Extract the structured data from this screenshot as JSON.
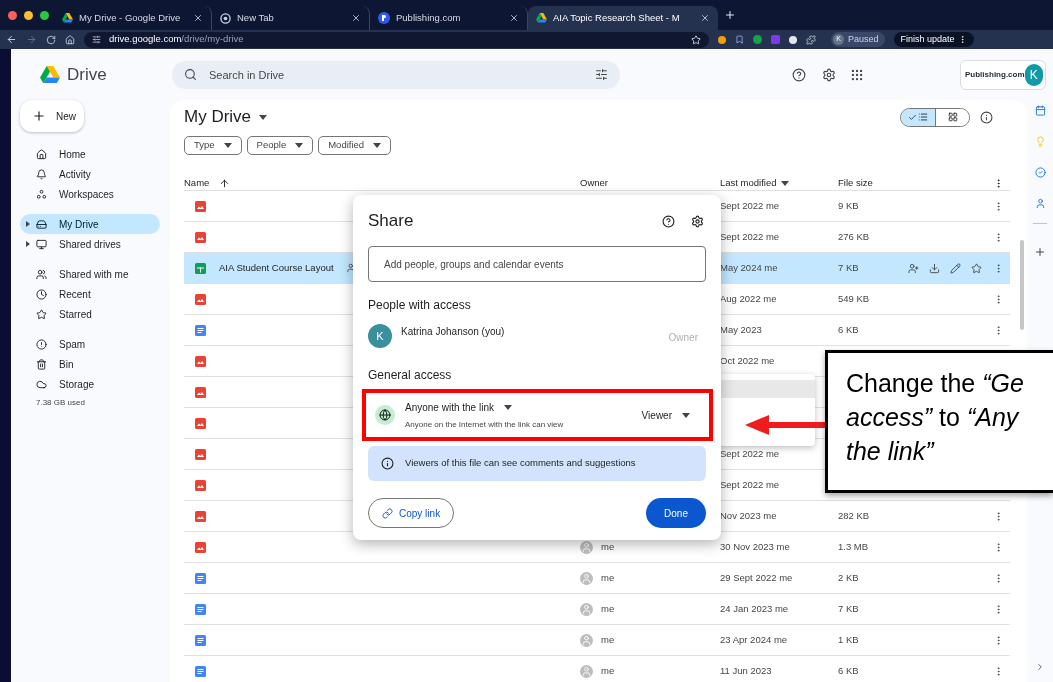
{
  "browser": {
    "tabs": [
      {
        "kind": "drive",
        "title": "My Drive - Google Drive",
        "selected": false
      },
      {
        "kind": "newtab",
        "title": "New Tab",
        "selected": false
      },
      {
        "kind": "publishing",
        "title": "Publishing.com",
        "selected": false
      },
      {
        "kind": "drive",
        "title": "AIA Topic Research Sheet - M",
        "selected": true
      }
    ],
    "url": {
      "domain": "drive.google.com",
      "path": "/drive/my-drive"
    },
    "profile": {
      "initial": "K",
      "status": "Paused"
    },
    "update_button": "Finish update"
  },
  "app": {
    "name": "Drive",
    "search": {
      "placeholder": "Search in Drive"
    },
    "account": {
      "org": "Publishing.com",
      "initial": "K"
    }
  },
  "sidebar": {
    "new_button": "New",
    "sections": [
      [
        {
          "label": "Home",
          "selected": false,
          "expandable": false
        },
        {
          "label": "Activity",
          "selected": false,
          "expandable": false
        },
        {
          "label": "Workspaces",
          "selected": false,
          "expandable": false
        }
      ],
      [
        {
          "label": "My Drive",
          "selected": true,
          "expandable": true
        },
        {
          "label": "Shared drives",
          "selected": false,
          "expandable": true
        }
      ],
      [
        {
          "label": "Shared with me",
          "selected": false,
          "expandable": false
        },
        {
          "label": "Recent",
          "selected": false,
          "expandable": false
        },
        {
          "label": "Starred",
          "selected": false,
          "expandable": false
        }
      ],
      [
        {
          "label": "Spam",
          "selected": false,
          "expandable": false
        },
        {
          "label": "Bin",
          "selected": false,
          "expandable": false
        },
        {
          "label": "Storage",
          "selected": false,
          "expandable": false
        }
      ]
    ],
    "storage_used": "7.38 GB used"
  },
  "main": {
    "title": "My Drive",
    "filters": [
      "Type",
      "People",
      "Modified"
    ],
    "views": [
      {
        "kind": "list",
        "selected": true
      },
      {
        "kind": "grid",
        "selected": false
      }
    ],
    "table": {
      "columns": [
        "Name",
        "Owner",
        "Last modified",
        "File size"
      ],
      "rows": [
        {
          "kind": "image",
          "shared": false,
          "modified": "Sept 2022 me",
          "size": "9 KB",
          "selected": false
        },
        {
          "kind": "image",
          "shared": false,
          "modified": "Sept 2022 me",
          "size": "276 KB",
          "selected": false
        },
        {
          "kind": "sheet",
          "name": "AIA Student Course Layout",
          "shared": true,
          "modified": "May 2024 me",
          "size": "7 KB",
          "selected": true
        },
        {
          "kind": "image",
          "shared": false,
          "modified": "Aug 2022 me",
          "size": "549 KB",
          "selected": false
        },
        {
          "kind": "doc",
          "shared": false,
          "modified": "May 2023",
          "size": "6 KB",
          "selected": false
        },
        {
          "kind": "image",
          "shared": false,
          "modified": "Oct 2022 me",
          "selected": false
        },
        {
          "kind": "image",
          "shared": false,
          "selected": false
        },
        {
          "kind": "image",
          "shared": false,
          "selected": false
        },
        {
          "kind": "image",
          "shared": false,
          "modified": "Sept 2022 me",
          "selected": false
        },
        {
          "kind": "image",
          "shared": false,
          "modified": "Sept 2022 me",
          "selected": false
        },
        {
          "kind": "image",
          "shared": false,
          "modified": "Nov 2023 me",
          "size": "282 KB",
          "selected": false
        },
        {
          "kind": "image",
          "shared": false,
          "owner": "me",
          "modified": "30 Nov 2023 me",
          "size": "1.3 MB",
          "selected": false
        },
        {
          "kind": "doc",
          "shared": false,
          "owner": "me",
          "modified": "29 Sept 2022 me",
          "size": "2 KB",
          "selected": false
        },
        {
          "kind": "doc",
          "shared": false,
          "owner": "me",
          "modified": "24 Jan 2023 me",
          "size": "7 KB",
          "selected": false
        },
        {
          "kind": "doc",
          "shared": false,
          "owner": "me",
          "modified": "23 Apr 2024 me",
          "size": "1 KB",
          "selected": false
        },
        {
          "kind": "doc",
          "shared": false,
          "owner": "me",
          "modified": "11 Jun 2023",
          "size": "6 KB",
          "selected": false
        }
      ]
    }
  },
  "share_dialog": {
    "title": "Share",
    "input_placeholder": "Add people, groups and calendar events",
    "people_heading": "People with access",
    "people": [
      {
        "initial": "K",
        "name": "Katrina Johanson (you)",
        "role": "Owner"
      }
    ],
    "general_heading": "General access",
    "access": {
      "label": "Anyone with the link",
      "description": "Anyone on the Internet with the link can view",
      "role": "Viewer",
      "highlighted": true
    },
    "info": "Viewers of this file can see comments and suggestions",
    "copy_link": "Copy link",
    "done": "Done"
  },
  "callout": {
    "lines": [
      "Change the *“Ge*",
      "*access”* to *“Any*",
      "*the link”*"
    ]
  }
}
